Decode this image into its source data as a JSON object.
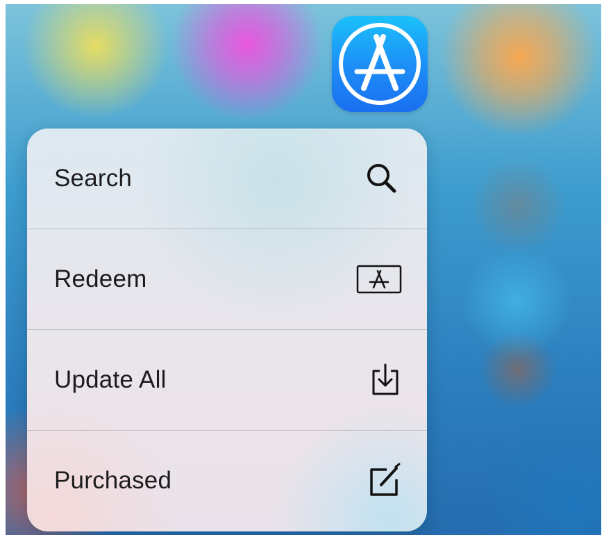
{
  "home_screen": {
    "app_icon": {
      "name": "App Store",
      "icon": "app-store-icon",
      "color": "#1d8cf6"
    }
  },
  "quick_actions": {
    "items": [
      {
        "label": "Search",
        "icon": "search-icon"
      },
      {
        "label": "Redeem",
        "icon": "redeem-icon"
      },
      {
        "label": "Update All",
        "icon": "update-all-icon"
      },
      {
        "label": "Purchased",
        "icon": "purchased-icon"
      }
    ]
  }
}
